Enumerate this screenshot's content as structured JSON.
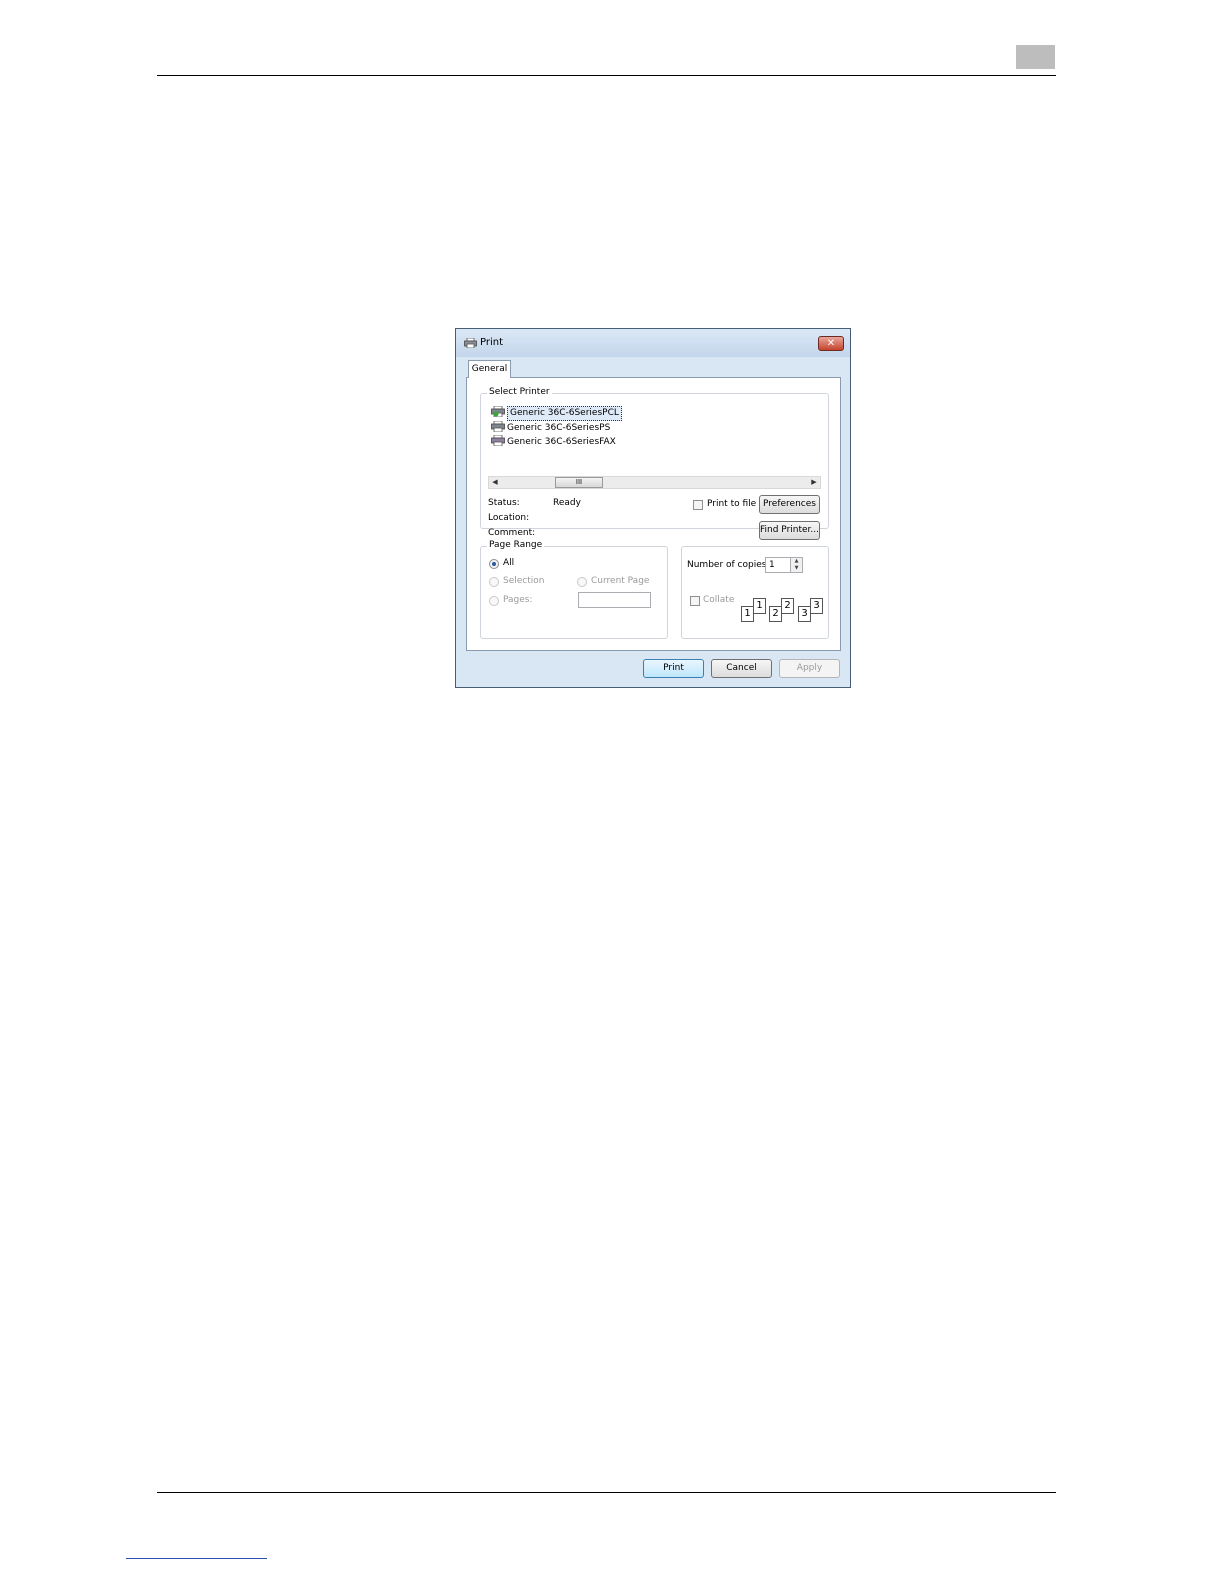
{
  "dialog": {
    "title": "Print",
    "close_label": "✕",
    "tab_general": "General",
    "select_printer": {
      "legend": "Select Printer",
      "printers": [
        {
          "name": "Generic 36C-6SeriesPCL",
          "icon": "printer-default-icon",
          "selected": true
        },
        {
          "name": "Generic 36C-6SeriesPS",
          "icon": "printer-icon",
          "selected": false
        },
        {
          "name": "Generic 36C-6SeriesFAX",
          "icon": "fax-printer-icon",
          "selected": false
        }
      ],
      "scroll_thumb": "III",
      "status_label": "Status:",
      "status_value": "Ready",
      "location_label": "Location:",
      "comment_label": "Comment:",
      "print_to_file": "Print to file",
      "preferences": "Preferences",
      "find_printer": "Find Printer..."
    },
    "page_range": {
      "legend": "Page Range",
      "all": "All",
      "selection": "Selection",
      "current_page": "Current Page",
      "pages": "Pages:"
    },
    "copies": {
      "label": "Number of copies:",
      "value": "1",
      "collate": "Collate",
      "collate_pages": [
        "1",
        "1",
        "2",
        "2",
        "3",
        "3"
      ]
    },
    "buttons": {
      "print": "Print",
      "cancel": "Cancel",
      "apply": "Apply"
    }
  },
  "colors": {
    "dialog_frame": "#d9e6f4",
    "close_button": "#c5432e",
    "header_box": "#bdbdbd"
  }
}
